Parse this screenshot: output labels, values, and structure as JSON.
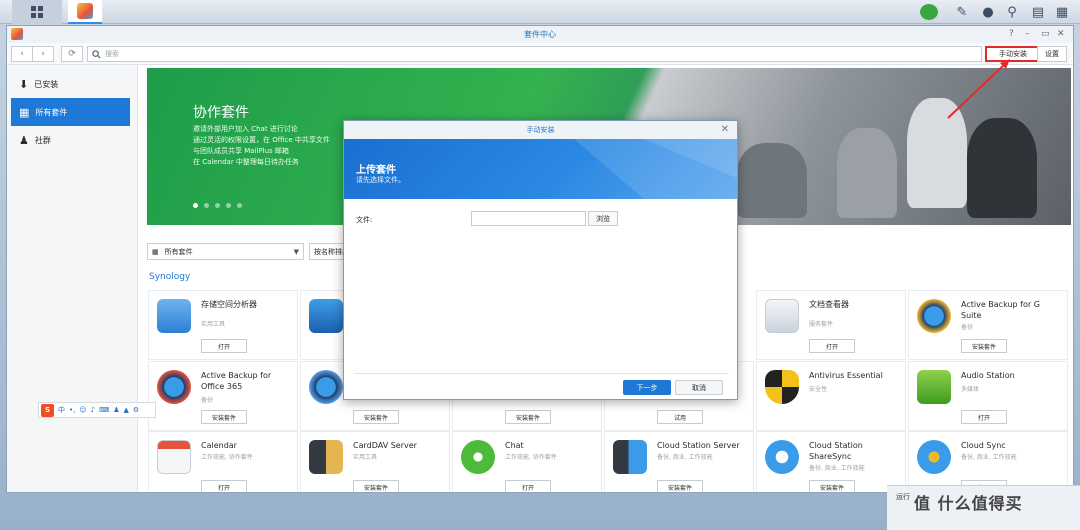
{
  "taskbar": {
    "icons": [
      "grid-icon",
      "package-center-icon",
      "notification-icon",
      "chat-icon",
      "user-icon",
      "search-icon",
      "widget-icon",
      "windows-icon"
    ]
  },
  "window": {
    "title": "套件中心",
    "controls": [
      "?",
      "–",
      "▭",
      "✕"
    ]
  },
  "toolbar": {
    "back": "‹",
    "forward": "›",
    "refresh": "⟳",
    "search_placeholder": "搜索",
    "manual_install_label": "手动安装",
    "settings_label": "设置"
  },
  "sidebar": {
    "items": [
      {
        "label": "已安装",
        "icon": "download-icon"
      },
      {
        "label": "所有套件",
        "icon": "grid-icon"
      },
      {
        "label": "社群",
        "icon": "community-icon"
      }
    ]
  },
  "banner": {
    "title": "协作套件",
    "lines": [
      "邀请外部用户加入 Chat 进行讨论",
      "通过灵活的权限设置，在 Office 中共享文件",
      "与团队成员共享 MailPlus 邮箱",
      "在 Calendar 中整理每日待办任务"
    ]
  },
  "filter": {
    "selected": "所有套件",
    "sort": "按名称排序"
  },
  "category": "Synology",
  "packages": [
    {
      "name": "存储空间分析器",
      "sub": "实用工具",
      "button": "打开"
    },
    {
      "name": "文档查看器",
      "sub": "服务套件",
      "button": "打开"
    },
    {
      "name": "Active Backup for G Suite",
      "sub": "备份",
      "button": "安装套件"
    },
    {
      "name": "Active Backup for Office 365",
      "sub": "备份",
      "button": "安装套件"
    },
    {
      "name": "Antivirus Essential",
      "sub": "安全性",
      "button": "试用"
    },
    {
      "name": "Audio Station",
      "sub": "多媒体",
      "button": "打开"
    },
    {
      "name": "Calendar",
      "sub": "工作效能, 协作套件",
      "button": "打开"
    },
    {
      "name": "CardDAV Server",
      "sub": "实用工具",
      "button": "安装套件"
    },
    {
      "name": "Chat",
      "sub": "工作效能, 协作套件",
      "button": "打开"
    },
    {
      "name": "Cloud Station Server",
      "sub": "备份, 商业, 工作效能",
      "button": "安装套件"
    },
    {
      "name": "Cloud Station ShareSync",
      "sub": "备份, 商业, 工作效能",
      "button": "安装套件"
    },
    {
      "name": "Cloud Sync",
      "sub": "备份, 商业, 工作效能",
      "button": "打开"
    }
  ],
  "hidden_buttons": {
    "row2_col2": "安装套件",
    "row2_col3": "安装套件"
  },
  "modal": {
    "title": "手动安装",
    "close": "✕",
    "header_title": "上传套件",
    "header_sub": "请先选择文件。",
    "file_label": "文件:",
    "browse_label": "浏览",
    "next_label": "下一步",
    "cancel_label": "取消"
  },
  "ime": {
    "logo": "S",
    "mode": "中"
  },
  "overlay": {
    "run_text": "运行",
    "watermark": "值 什么值得买"
  },
  "colors": {
    "accent": "#1d78d6",
    "highlight": "#e32b2b",
    "banner_green": "#2fa84f"
  }
}
